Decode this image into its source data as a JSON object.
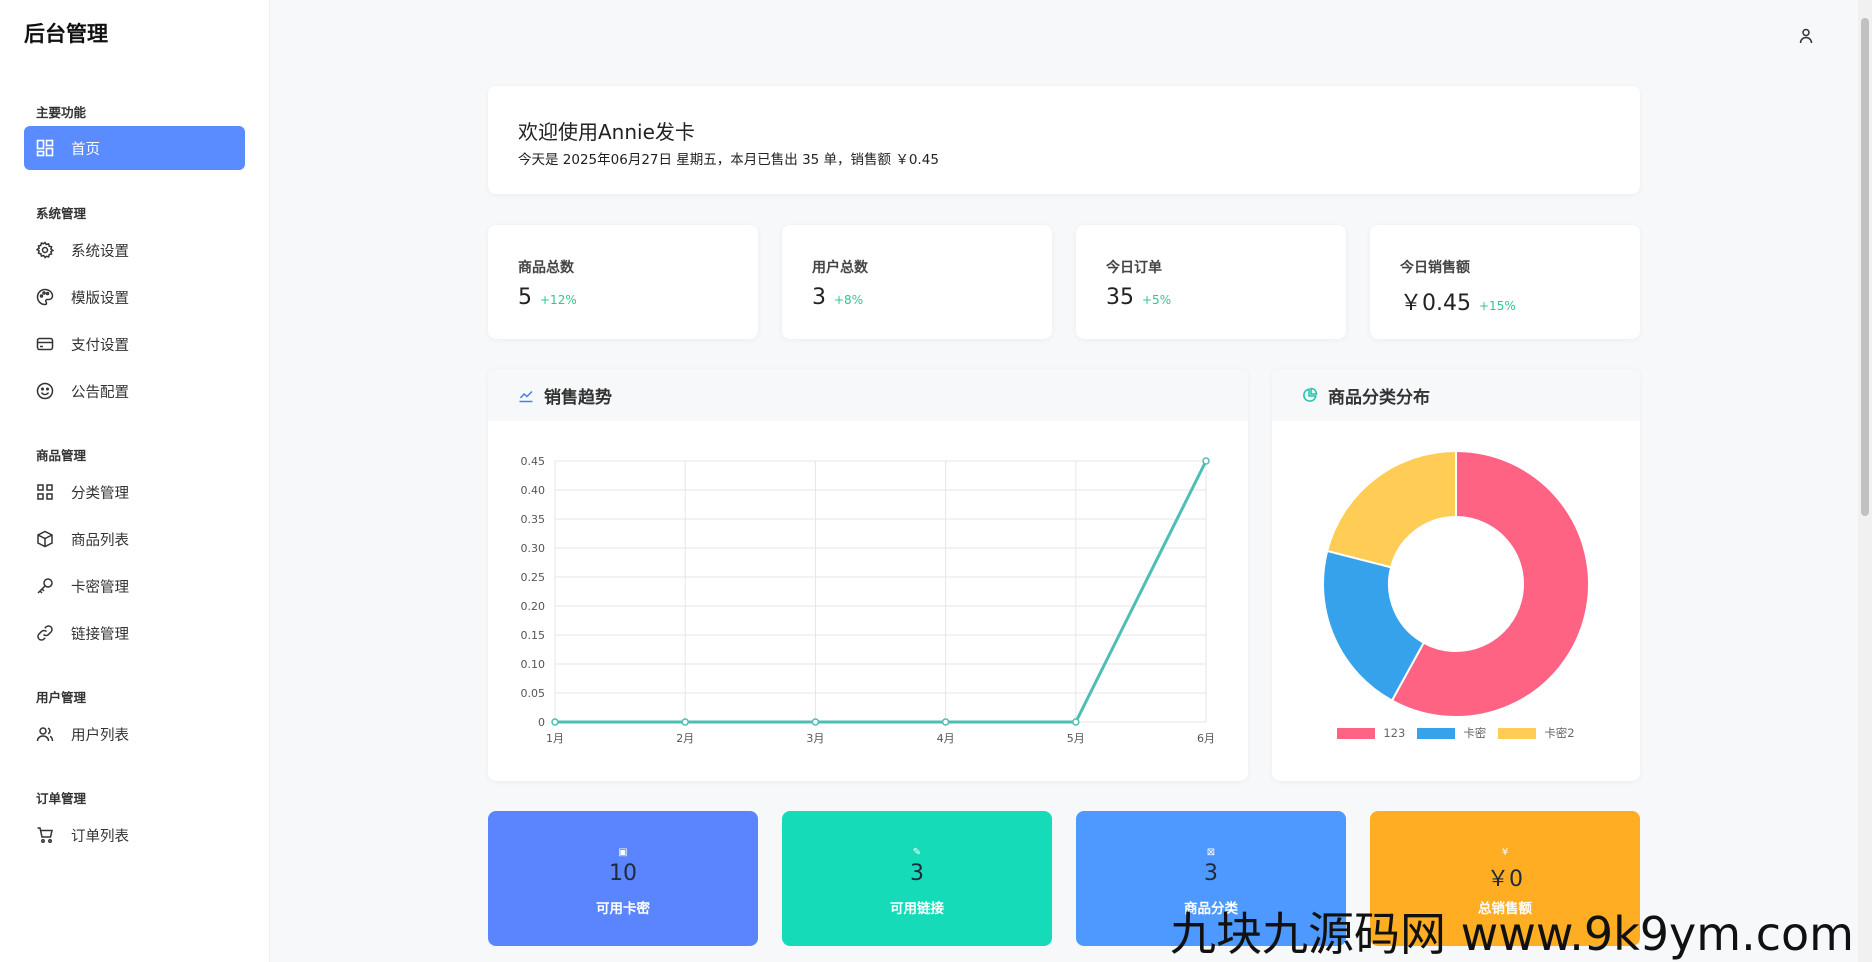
{
  "sidebar": {
    "brand": "后台管理",
    "groups": [
      {
        "label": "主要功能"
      },
      {
        "label": "系统管理"
      },
      {
        "label": "商品管理"
      },
      {
        "label": "用户管理"
      },
      {
        "label": "订单管理"
      }
    ],
    "items": [
      {
        "label": "首页",
        "icon": "dashboard-icon",
        "active": true
      },
      {
        "label": "系统设置",
        "icon": "gear-icon"
      },
      {
        "label": "模版设置",
        "icon": "palette-icon"
      },
      {
        "label": "支付设置",
        "icon": "credit-card-icon"
      },
      {
        "label": "公告配置",
        "icon": "smile-icon"
      },
      {
        "label": "分类管理",
        "icon": "grid-icon"
      },
      {
        "label": "商品列表",
        "icon": "box-icon"
      },
      {
        "label": "卡密管理",
        "icon": "key-icon"
      },
      {
        "label": "链接管理",
        "icon": "link-icon"
      },
      {
        "label": "用户列表",
        "icon": "users-icon"
      },
      {
        "label": "订单列表",
        "icon": "cart-icon"
      }
    ]
  },
  "header": {
    "user_icon": "user-icon"
  },
  "welcome": {
    "title": "欢迎使用Annie发卡",
    "subtitle": "今天是 2025年06月27日 星期五，本月已售出 35 单，销售额 ￥0.45"
  },
  "stats": [
    {
      "label": "商品总数",
      "value": "5",
      "trend": "+12%"
    },
    {
      "label": "用户总数",
      "value": "3",
      "trend": "+8%"
    },
    {
      "label": "今日订单",
      "value": "35",
      "trend": "+5%"
    },
    {
      "label": "今日销售额",
      "value": "￥0.45",
      "trend": "+15%"
    }
  ],
  "sales_panel": {
    "title": "销售趋势",
    "icon": "line-chart-icon"
  },
  "category_panel": {
    "title": "商品分类分布",
    "icon": "pie-chart-icon"
  },
  "chart_data": [
    {
      "type": "line",
      "x": [
        "1月",
        "2月",
        "3月",
        "4月",
        "5月",
        "6月"
      ],
      "series": [
        {
          "values": [
            0,
            0,
            0,
            0,
            0,
            0.45
          ],
          "color": "#4dbdb5"
        }
      ],
      "ylim": [
        0,
        0.45
      ],
      "yticks": [
        "0",
        "0.05",
        "0.10",
        "0.15",
        "0.20",
        "0.25",
        "0.30",
        "0.35",
        "0.40",
        "0.45"
      ],
      "grid": true
    },
    {
      "type": "pie",
      "donut": true,
      "labels": [
        "123",
        "卡密",
        "卡密2"
      ],
      "values": [
        58,
        21,
        21
      ],
      "colors": [
        "#ff6384",
        "#36a2eb",
        "#ffcd56"
      ],
      "legend": "bottom"
    }
  ],
  "summary_cards": [
    {
      "icon": "▣",
      "value": "10",
      "label": "可用卡密",
      "color": "#5b84ff"
    },
    {
      "icon": "✎",
      "value": "3",
      "label": "可用链接",
      "color": "#15dbb8"
    },
    {
      "icon": "⊠",
      "value": "3",
      "label": "商品分类",
      "color": "#4d99ff"
    },
    {
      "icon": "¥",
      "value": "￥0",
      "label": "总销售额",
      "color": "#ffad22"
    }
  ],
  "watermark": "九块九源码网 www.9k9ym.com"
}
